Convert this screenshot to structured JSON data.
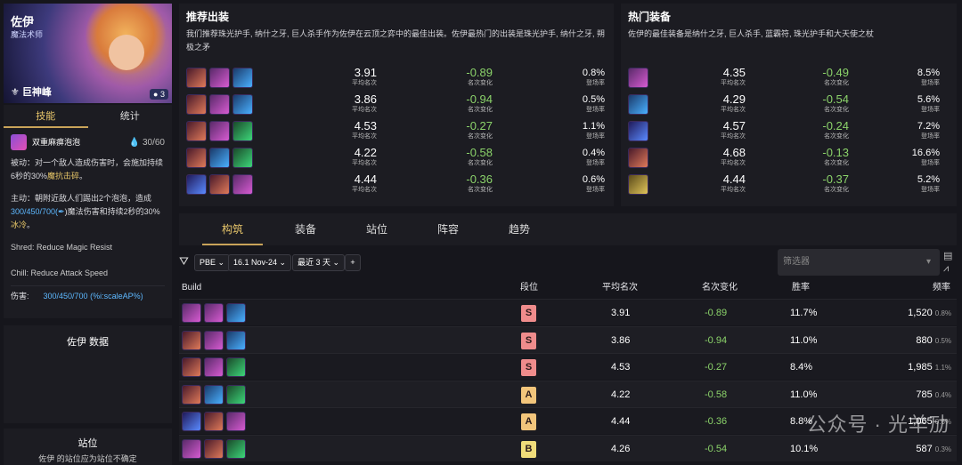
{
  "champion": {
    "name": "佐伊",
    "role": "魔法术师",
    "trait": "巨神峰",
    "cost": "3",
    "tabs": [
      "技能",
      "统计"
    ],
    "skill": {
      "name": "双重麻痹泡泡",
      "mana": "30/60",
      "passive_prefix": "被动：对一个敌人造成伤害时，会施加持续6秒的30%",
      "passive_hl": "魔抗击碎",
      "passive_suffix": "。",
      "active_prefix": "主动：朝附近敌人们踢出2个泡泡，造成",
      "active_vals": "300/450/700(",
      "active_mid": ")魔法伤害和持续2秒的30%",
      "active_hl": "冰冷",
      "active_suffix": "。",
      "shred": "Shred: Reduce Magic Resist",
      "chill": "Chill: Reduce Attack Speed",
      "damage_label": "伤害:",
      "damage_value": "300/450/700  (%i:scaleAP%)"
    },
    "data_title": "佐伊 数据",
    "position_title": "站位",
    "position_desc": "佐伊 的站位应为站位不确定"
  },
  "recommended": {
    "title": "推荐出装",
    "desc": "我们推荐珠光护手, 纳什之牙, 巨人杀手作为佐伊在云顶之弈中的最佳出装。佐伊最热门的出装是珠光护手, 纳什之牙, 朔极之矛",
    "rows": [
      {
        "icons": [
          "b",
          "a",
          "c"
        ],
        "avg": "3.91",
        "avg_l": "平均名次",
        "chg": "-0.89",
        "chg_l": "名次变化",
        "rate": "0.8%",
        "rate_l": "登场率"
      },
      {
        "icons": [
          "b",
          "a",
          "c"
        ],
        "avg": "3.86",
        "avg_l": "平均名次",
        "chg": "-0.94",
        "chg_l": "名次变化",
        "rate": "0.5%",
        "rate_l": "登场率"
      },
      {
        "icons": [
          "b",
          "a",
          "d"
        ],
        "avg": "4.53",
        "avg_l": "平均名次",
        "chg": "-0.27",
        "chg_l": "名次变化",
        "rate": "1.1%",
        "rate_l": "登场率"
      },
      {
        "icons": [
          "b",
          "c",
          "d"
        ],
        "avg": "4.22",
        "avg_l": "平均名次",
        "chg": "-0.58",
        "chg_l": "名次变化",
        "rate": "0.4%",
        "rate_l": "登场率"
      },
      {
        "icons": [
          "e",
          "b",
          "a"
        ],
        "avg": "4.44",
        "avg_l": "平均名次",
        "chg": "-0.36",
        "chg_l": "名次变化",
        "rate": "0.6%",
        "rate_l": "登场率"
      }
    ]
  },
  "hot": {
    "title": "热门装备",
    "desc": "佐伊的最佳装备是纳什之牙, 巨人杀手, 蓝霸符, 珠光护手和大天使之杖",
    "rows": [
      {
        "icon": "a",
        "avg": "4.35",
        "avg_l": "平均名次",
        "chg": "-0.49",
        "chg_l": "名次变化",
        "rate": "8.5%",
        "rate_l": "登场率"
      },
      {
        "icon": "c",
        "avg": "4.29",
        "avg_l": "平均名次",
        "chg": "-0.54",
        "chg_l": "名次变化",
        "rate": "5.6%",
        "rate_l": "登场率"
      },
      {
        "icon": "e",
        "avg": "4.57",
        "avg_l": "平均名次",
        "chg": "-0.24",
        "chg_l": "名次变化",
        "rate": "7.2%",
        "rate_l": "登场率"
      },
      {
        "icon": "b",
        "avg": "4.68",
        "avg_l": "平均名次",
        "chg": "-0.13",
        "chg_l": "名次变化",
        "rate": "16.6%",
        "rate_l": "登场率"
      },
      {
        "icon": "f",
        "avg": "4.44",
        "avg_l": "平均名次",
        "chg": "-0.37",
        "chg_l": "名次变化",
        "rate": "5.2%",
        "rate_l": "登场率"
      }
    ]
  },
  "nav": {
    "tabs": [
      "构筑",
      "装备",
      "站位",
      "阵容",
      "趋势"
    ]
  },
  "filters": {
    "patch": "PBE",
    "version": "16.1 Nov-24",
    "period": "最近 3 天",
    "add": "+",
    "selector_placeholder": "筛选器"
  },
  "table": {
    "headers": {
      "build": "Build",
      "tier": "段位",
      "avg": "平均名次",
      "chg": "名次变化",
      "win": "胜率",
      "freq": "频率"
    },
    "rows": [
      {
        "icons": [
          "a",
          "a",
          "c"
        ],
        "tier": "S",
        "avg": "3.91",
        "chg": "-0.89",
        "win": "11.7%",
        "freq": "1,520",
        "freq_pct": "0.8%"
      },
      {
        "icons": [
          "b",
          "a",
          "c"
        ],
        "tier": "S",
        "avg": "3.86",
        "chg": "-0.94",
        "win": "11.0%",
        "freq": "880",
        "freq_pct": "0.5%"
      },
      {
        "icons": [
          "b",
          "a",
          "d"
        ],
        "tier": "S",
        "avg": "4.53",
        "chg": "-0.27",
        "win": "8.4%",
        "freq": "1,985",
        "freq_pct": "1.1%"
      },
      {
        "icons": [
          "b",
          "c",
          "d"
        ],
        "tier": "A",
        "avg": "4.22",
        "chg": "-0.58",
        "win": "11.0%",
        "freq": "785",
        "freq_pct": "0.4%"
      },
      {
        "icons": [
          "e",
          "b",
          "a"
        ],
        "tier": "A",
        "avg": "4.44",
        "chg": "-0.36",
        "win": "8.8%",
        "freq": "1,065",
        "freq_pct": "0.6%"
      },
      {
        "icons": [
          "a",
          "b",
          "d"
        ],
        "tier": "B",
        "avg": "4.26",
        "chg": "-0.54",
        "win": "10.1%",
        "freq": "587",
        "freq_pct": "0.3%"
      }
    ]
  },
  "watermark": "公众号 · 光羊劢"
}
